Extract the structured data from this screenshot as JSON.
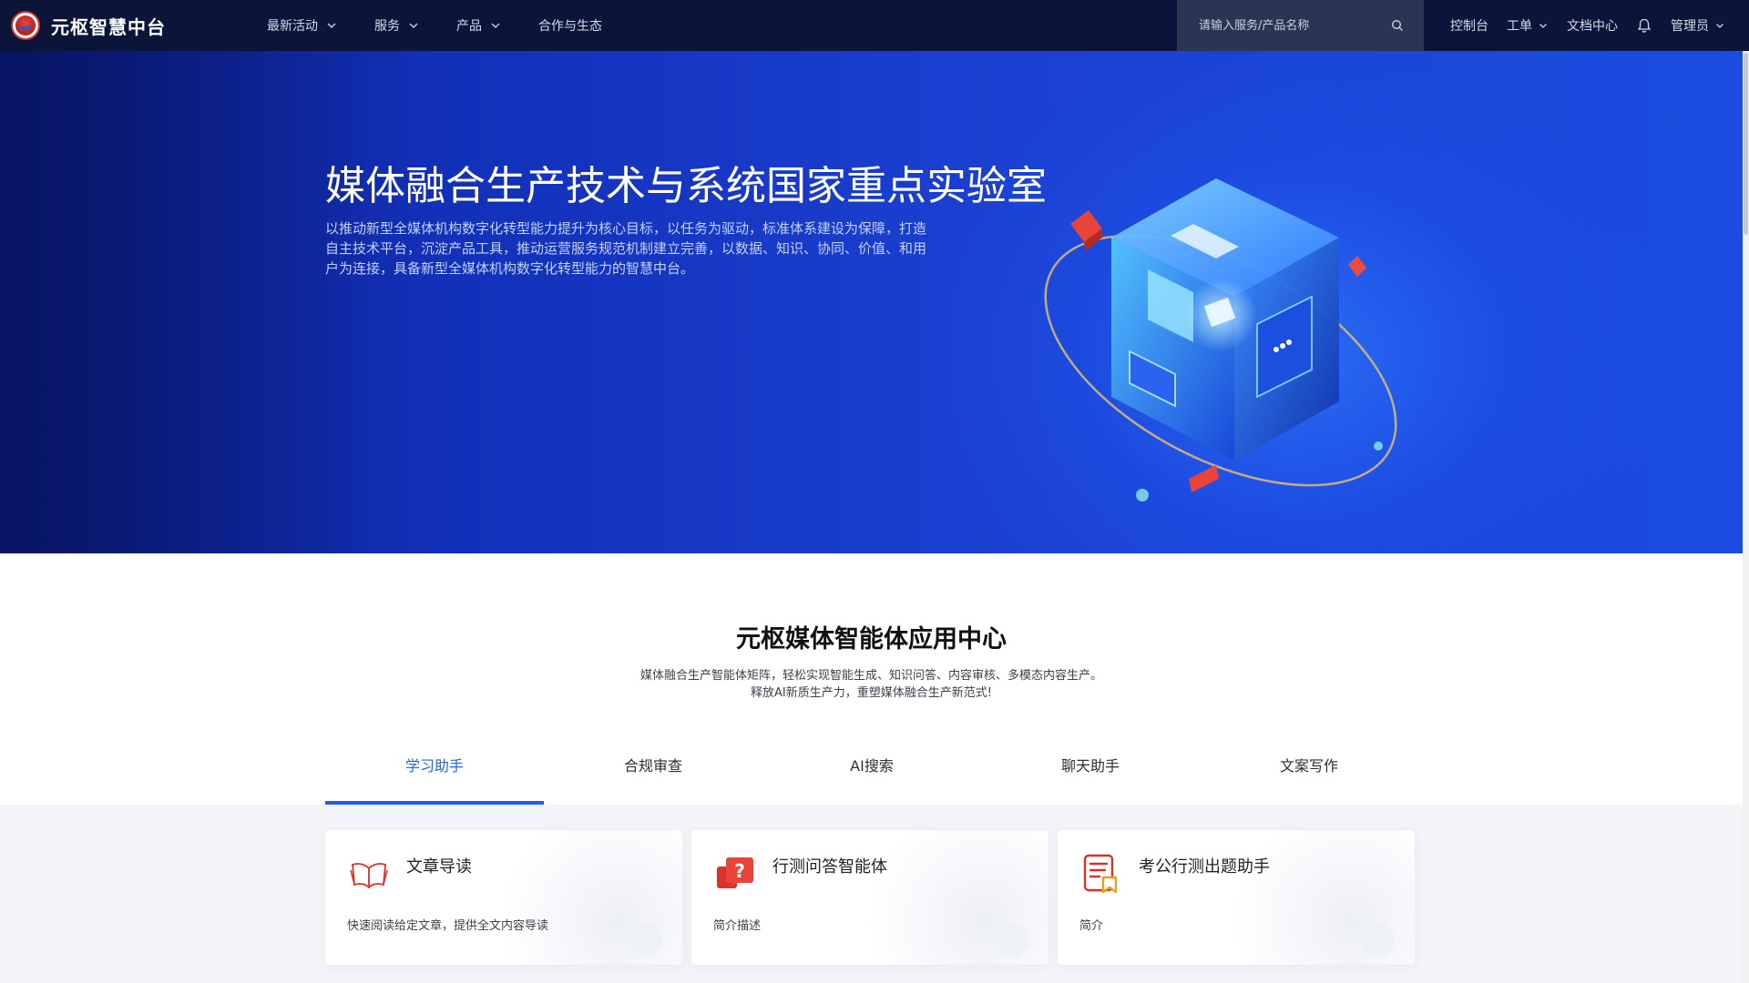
{
  "brand": {
    "name": "元枢智慧中台"
  },
  "nav": {
    "items": [
      {
        "label": "最新活动",
        "has_dropdown": true
      },
      {
        "label": "服务",
        "has_dropdown": true
      },
      {
        "label": "产品",
        "has_dropdown": true
      },
      {
        "label": "合作与生态",
        "has_dropdown": false
      }
    ]
  },
  "search": {
    "placeholder": "请输入服务/产品名称",
    "icon": "search-icon"
  },
  "right_nav": {
    "console": "控制台",
    "ticket": "工单",
    "docs": "文档中心",
    "bell_icon": "bell-icon",
    "user": "管理员"
  },
  "hero": {
    "title": "媒体融合生产技术与系统国家重点实验室",
    "description": "以推动新型全媒体机构数字化转型能力提升为核心目标，以任务为驱动，标准体系建设为保障，打造自主技术平台，沉淀产品工具，推动运营服务规范机制建立完善，以数据、知识、协同、价值、和用户为连接，具备新型全媒体机构数字化转型能力的智慧中台。"
  },
  "section": {
    "title": "元枢媒体智能体应用中心",
    "desc_line1": "媒体融合生产智能体矩阵，轻松实现智能生成、知识问答、内容审核、多模态内容生产。",
    "desc_line2": "释放AI新质生产力，重塑媒体融合生产新范式!"
  },
  "tabs": [
    {
      "label": "学习助手",
      "active": true
    },
    {
      "label": "合规审查",
      "active": false
    },
    {
      "label": "AI搜索",
      "active": false
    },
    {
      "label": "聊天助手",
      "active": false
    },
    {
      "label": "文案写作",
      "active": false
    }
  ],
  "cards": [
    {
      "title": "文章导读",
      "desc": "快速阅读给定文章，提供全文内容导读",
      "icon": "open-book-icon"
    },
    {
      "title": "行测问答智能体",
      "desc": "简介描述",
      "icon": "question-chat-icon"
    },
    {
      "title": "考公行测出题助手",
      "desc": "简介",
      "icon": "document-bookmark-icon"
    }
  ],
  "colors": {
    "topbar": "#0b1539",
    "accent": "#2164e8",
    "hero_deep": "#0b1a7a",
    "hero_bright": "#2a6cf7",
    "card_icon_red": "#d9322b"
  }
}
